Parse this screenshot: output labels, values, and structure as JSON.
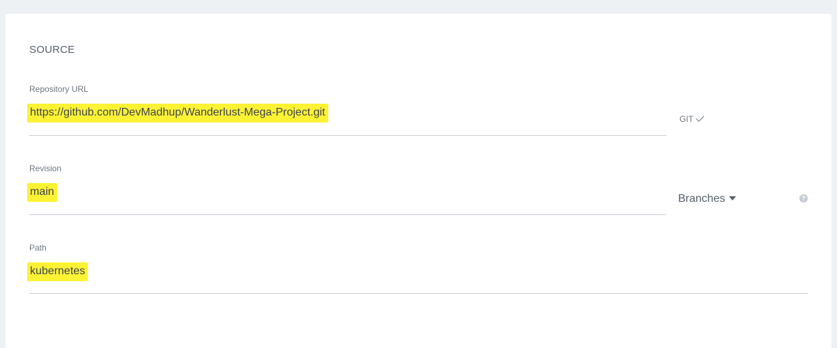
{
  "source": {
    "section_title": "SOURCE",
    "repository": {
      "label": "Repository URL",
      "value": "https://github.com/DevMadhup/Wanderlust-Mega-Project.git",
      "type_indicator": "GIT",
      "type_icon": "check-icon"
    },
    "revision": {
      "label": "Revision",
      "value": "main",
      "branches_label": "Branches",
      "branches_icon": "caret-down-icon",
      "help_icon": "question-circle-icon",
      "help_glyph": "?"
    },
    "path": {
      "label": "Path",
      "value": "kubernetes"
    }
  },
  "colors": {
    "background": "#eef1f4",
    "card": "#ffffff",
    "highlight": "#fdf233",
    "underline": "#c9cfd6",
    "text": "#3d4652"
  }
}
